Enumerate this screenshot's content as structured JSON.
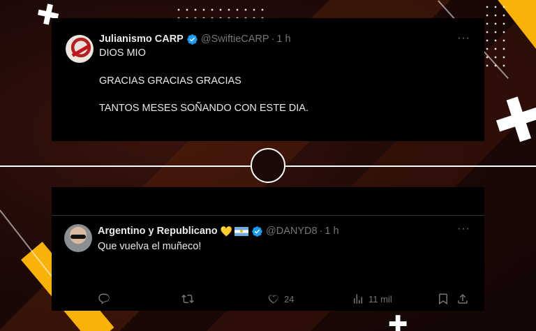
{
  "tweet1": {
    "name": "Julianismo CARP",
    "handle": "@SwiftieCARP",
    "separator": "·",
    "time": "1 h",
    "more_label": "···",
    "lines": [
      "DIOS MIO",
      "GRACIAS GRACIAS GRACIAS",
      "TANTOS MESES SOÑANDO CON ESTE DIA."
    ]
  },
  "tweet2": {
    "name": "Argentino y Republicano",
    "handle": "@DANYD8",
    "separator": "·",
    "time": "1 h",
    "more_label": "···",
    "text": "Que vuelva el muñeco!",
    "heart_emoji": "💛",
    "actions": {
      "reply_count": "",
      "retweet_count": "",
      "like_count": "24",
      "views_count": "11 mil"
    }
  },
  "colors": {
    "accent_yellow": "#f9b20a",
    "verified_blue": "#1d9bf0",
    "card_bg": "#000000",
    "muted_text": "#71767b"
  },
  "icons": [
    "plus-cross-icon",
    "verified-badge-icon",
    "more-options-icon",
    "argentina-flag-icon",
    "reply-icon",
    "retweet-icon",
    "like-icon",
    "views-icon",
    "bookmark-icon",
    "share-icon"
  ]
}
